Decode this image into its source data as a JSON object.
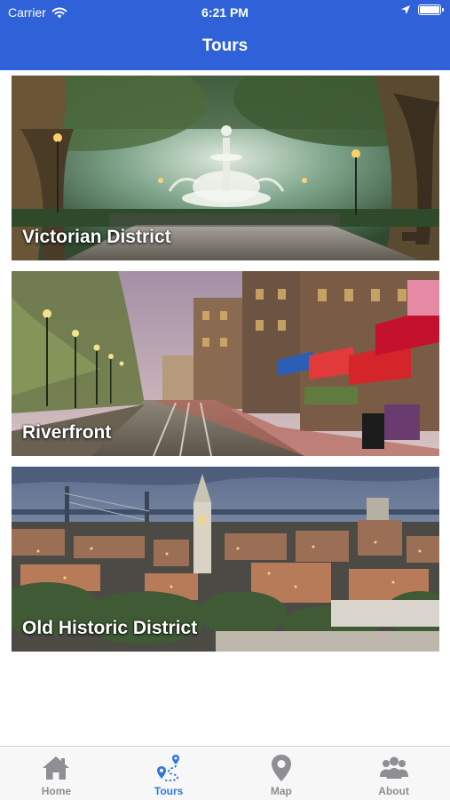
{
  "status_bar": {
    "carrier": "Carrier",
    "time": "6:21 PM"
  },
  "nav": {
    "title": "Tours"
  },
  "tours": [
    {
      "name": "Victorian District"
    },
    {
      "name": "Riverfront"
    },
    {
      "name": "Old Historic District"
    }
  ],
  "tabbar": {
    "active_tab": "Tours",
    "active_color": "#2f77e0",
    "inactive_color": "#8e8e93",
    "tabs": [
      {
        "label": "Home",
        "icon": "home-icon"
      },
      {
        "label": "Tours",
        "icon": "tours-route-icon"
      },
      {
        "label": "Map",
        "icon": "map-pin-icon"
      },
      {
        "label": "About",
        "icon": "people-icon"
      }
    ]
  },
  "colors": {
    "header_bg": "#2f62d8"
  }
}
